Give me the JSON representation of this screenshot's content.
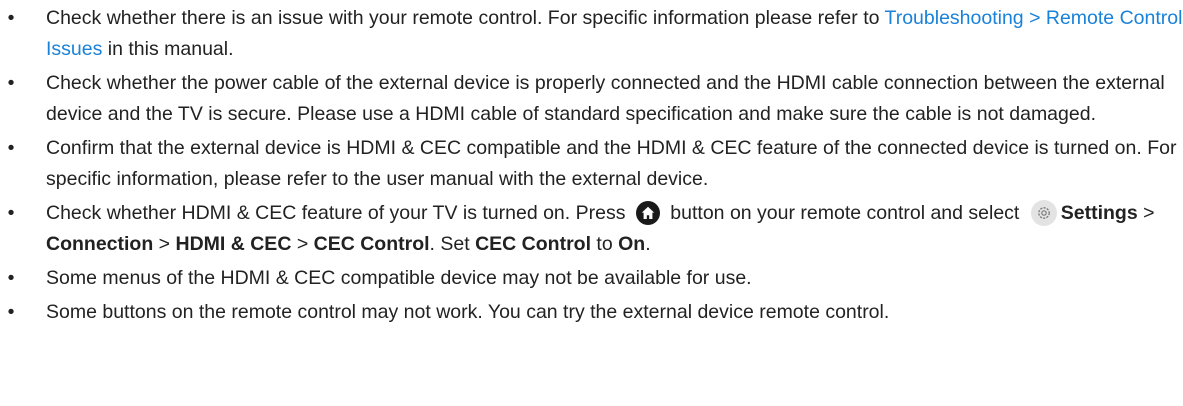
{
  "bullet_char": "•",
  "items": [
    {
      "a": "Check whether there is an issue with your remote control. For specific information please refer to ",
      "link": "Troubleshooting > Remote Control Issues",
      "b": " in this manual."
    },
    {
      "text": "Check whether the power cable of the external device is properly connected and the HDMI cable connection between the external device and the TV is secure. Please use a HDMI cable of standard specification and make sure the cable is not damaged."
    },
    {
      "text": "Confirm that the external device is HDMI & CEC compatible and the HDMI & CEC feature of the connected device is turned on. For specific information, please refer to the user manual with the external device."
    },
    {
      "p1": "Check whether HDMI & CEC feature of your TV is turned on. Press ",
      "home_icon": "home-icon",
      "p2": " button on your remote control and select ",
      "settings_icon": "gear-icon",
      "settings": "Settings",
      "sep": " > ",
      "connection": "Connection",
      "hdmi_cec": "HDMI & CEC",
      "cec_control": "CEC Control",
      "p3": ". Set ",
      "p4": " to ",
      "on": "On",
      "p5": "."
    },
    {
      "text": "Some menus of the HDMI & CEC compatible device may not be available for use."
    },
    {
      "text": "Some buttons on the remote control may not work. You can try the external device remote control."
    }
  ],
  "colors": {
    "text": "#222222",
    "link": "#1a82d8",
    "home_icon_bg": "#1a1a1a",
    "gear_icon_bg": "#e3e3e3"
  }
}
